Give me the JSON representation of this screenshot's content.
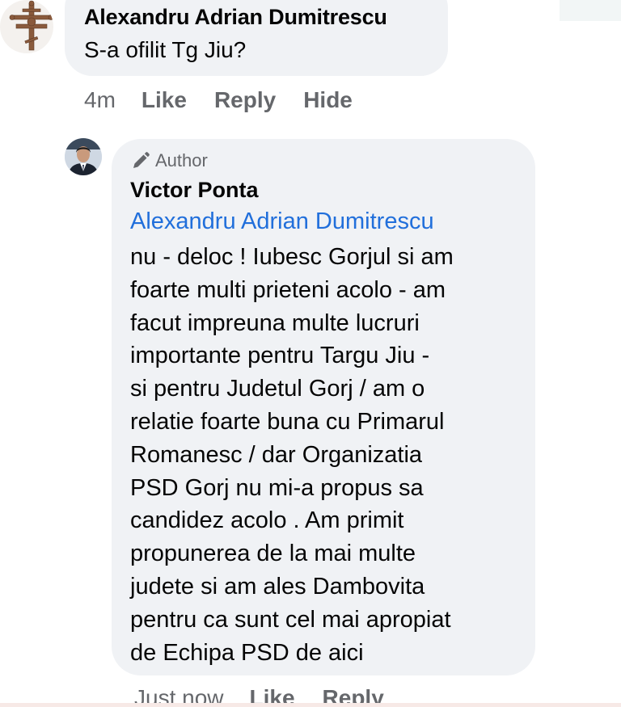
{
  "comment": {
    "author": "Alexandru Adrian Dumitrescu",
    "text": "S-a ofilit Tg Jiu?",
    "time": "4m",
    "actions": {
      "like": "Like",
      "reply": "Reply",
      "hide": "Hide"
    },
    "avatar_icon": "orthodox-cross-icon"
  },
  "reply": {
    "badge_icon": "pencil-icon",
    "badge_label": "Author",
    "author": "Victor Ponta",
    "mention": "Alexandru Adrian Dumitrescu",
    "lines": [
      "nu - deloc ! Iubesc Gorjul si am",
      "foarte multi prieteni acolo - am",
      "facut impreuna multe lucruri",
      "importante pentru Targu Jiu -",
      "si pentru Judetul Gorj / am o",
      "relatie foarte buna cu Primarul",
      "Romanesc / dar Organizatia",
      "PSD Gorj nu mi-a propus sa",
      "candidez acolo . Am primit",
      "propunerea de la mai multe",
      "judete si am ales Dambovita",
      "pentru ca sunt cel mai apropiat",
      "de Echipa PSD de aici"
    ],
    "time": "Just now",
    "actions": {
      "like": "Like",
      "reply": "Reply"
    }
  },
  "colors": {
    "bubble": "#f0f2f5",
    "mention_link": "#216fdb",
    "meta_text": "#65676b",
    "text": "#050505"
  }
}
